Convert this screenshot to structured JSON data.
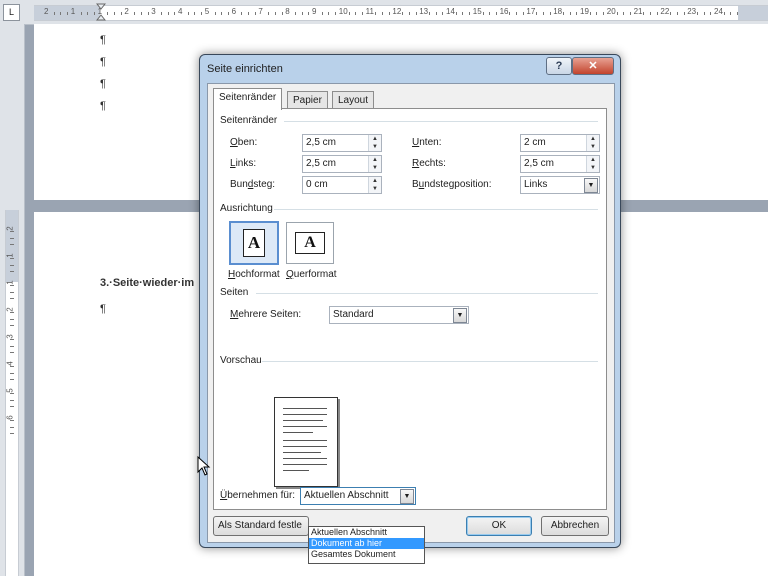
{
  "ruler": {
    "corner_icon": "L",
    "h_numbers": [
      "2",
      "1",
      "1",
      "2",
      "3",
      "4",
      "5",
      "6",
      "7",
      "8",
      "9",
      "10",
      "11",
      "12",
      "13",
      "14",
      "15",
      "16",
      "17",
      "18",
      "19",
      "20",
      "21",
      "22",
      "23",
      "24"
    ],
    "v_numbers": [
      "2",
      "1",
      "1",
      "2",
      "3",
      "4",
      "5",
      "6"
    ]
  },
  "document": {
    "pilcrow": "¶",
    "heading": "3.·Seite·wieder·im"
  },
  "dialog": {
    "title": "Seite einrichten",
    "help_glyph": "?",
    "close_glyph": "✕",
    "tabs": [
      {
        "label": "Seitenränder",
        "active": true
      },
      {
        "label": "Papier",
        "active": false
      },
      {
        "label": "Layout",
        "active": false
      }
    ],
    "margins": {
      "section": "Seitenränder",
      "top": {
        "label_u": "O",
        "label_rest": "ben:",
        "value": "2,5 cm"
      },
      "bottom": {
        "label_u": "U",
        "label_rest": "nten:",
        "value": "2 cm"
      },
      "left": {
        "label_u": "L",
        "label_rest": "inks:",
        "value": "2,5 cm"
      },
      "right": {
        "label_u": "R",
        "label_rest": "echts:",
        "value": "2,5 cm"
      },
      "gutter": {
        "label_pre": "Bun",
        "label_u": "d",
        "label_rest": "steg:",
        "value": "0 cm"
      },
      "gutter_pos": {
        "label_pre": "B",
        "label_u": "u",
        "label_rest": "ndstegposition:",
        "value": "Links"
      }
    },
    "orientation": {
      "section": "Ausrichtung",
      "portrait": {
        "glyph": "A",
        "label_u": "H",
        "label_rest": "ochformat",
        "selected": true
      },
      "landscape": {
        "glyph": "A",
        "label_u": "Q",
        "label_rest": "uerformat",
        "selected": false
      }
    },
    "pages": {
      "section": "Seiten",
      "multiple": {
        "label_u": "M",
        "label_rest": "ehrere Seiten:",
        "value": "Standard"
      }
    },
    "preview": {
      "section": "Vorschau"
    },
    "apply": {
      "label_u": "Ü",
      "label_rest": "bernehmen für:",
      "value": "Aktuellen Abschnitt",
      "options": [
        "Aktuellen Abschnitt",
        "Dokument ab hier",
        "Gesamtes Dokument"
      ],
      "highlighted": 1
    },
    "buttons": {
      "default": "Als Standard festle",
      "ok": "OK",
      "cancel": "Abbrechen"
    },
    "accent_color": "#3399ff"
  }
}
